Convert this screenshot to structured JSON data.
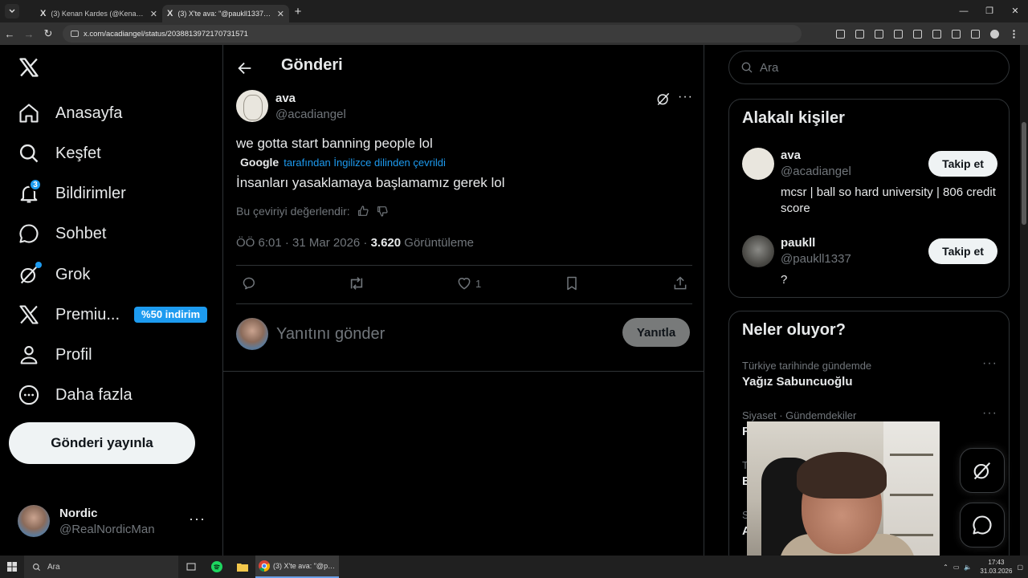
{
  "browser": {
    "tabs": [
      {
        "label": "(3) Kenan Kardes (@KenanKardes",
        "active": false
      },
      {
        "label": "(3) X'te ava: \"@paukll1337 we gotta",
        "active": true
      }
    ],
    "url": "x.com/acadiangel/status/2038813972170731571"
  },
  "leftnav": {
    "items": [
      {
        "label": "Anasayfa",
        "icon": "home-icon"
      },
      {
        "label": "Keşfet",
        "icon": "search-icon"
      },
      {
        "label": "Bildirimler",
        "icon": "bell-icon",
        "badge": "3"
      },
      {
        "label": "Sohbet",
        "icon": "chat-icon"
      },
      {
        "label": "Grok",
        "icon": "grok-icon"
      },
      {
        "label": "Premiu...",
        "icon": "x-icon",
        "pill": "%50 indirim"
      },
      {
        "label": "Profil",
        "icon": "person-icon"
      },
      {
        "label": "Daha fazla",
        "icon": "more-circle-icon"
      }
    ],
    "post_button": "Gönderi yayınla",
    "account": {
      "name": "Nordic",
      "handle": "@RealNordicMan"
    }
  },
  "main": {
    "title": "Gönderi",
    "tweet": {
      "name": "ava",
      "handle": "@acadiangel",
      "text": "we gotta start banning people lol",
      "translation_brand": "Google",
      "translation_note": "tarafından İngilizce dilinden çevrildi",
      "translated_text": "İnsanları yasaklamaya başlamamız gerek lol",
      "rate_label": "Bu çeviriyi değerlendir:",
      "time": "ÖÖ 6:01 · 31 Mar 2026 · ",
      "views": "3.620",
      "views_label": " Görüntüleme",
      "likes": "1"
    },
    "reply": {
      "placeholder": "Yanıtını gönder",
      "button": "Yanıtla"
    }
  },
  "right": {
    "search_placeholder": "Ara",
    "related": {
      "title": "Alakalı kişiler",
      "people": [
        {
          "name": "ava",
          "handle": "@acadiangel",
          "bio": "mcsr | ball so hard university | 806 credit score",
          "follow": "Takip et"
        },
        {
          "name": "paukll",
          "handle": "@paukll1337",
          "bio": "?",
          "follow": "Takip et"
        }
      ]
    },
    "trends": {
      "title": "Neler oluyor?",
      "items": [
        {
          "context": "Türkiye tarihinde gündemde",
          "topic": "Yağız Sabuncuoğlu"
        },
        {
          "context": "Siyaset · Gündemdekiler",
          "topic": "F"
        },
        {
          "context": "T",
          "topic": "E"
        },
        {
          "context": "S",
          "topic": "A"
        }
      ]
    }
  },
  "taskbar": {
    "search": "Ara",
    "chrome_window": "(3) X'te ava: \"@pau...",
    "time": "17:43",
    "date": "31.03.2026"
  },
  "colors": {
    "accent": "#1d9bf0",
    "border": "#2f3336",
    "muted": "#71767b"
  }
}
